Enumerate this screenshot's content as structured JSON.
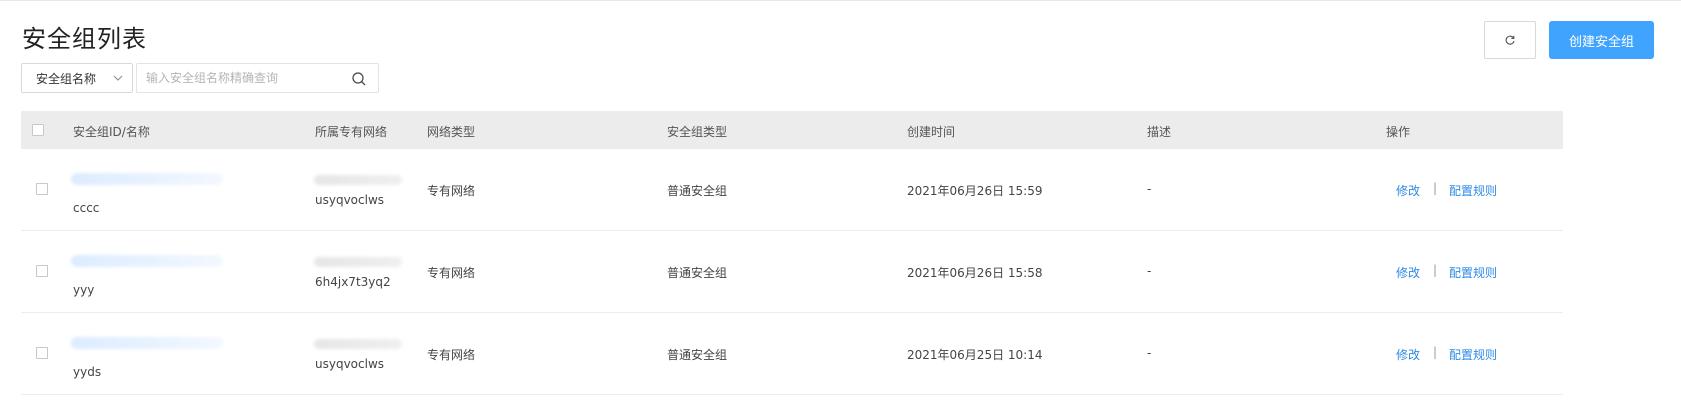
{
  "page": {
    "title": "安全组列表"
  },
  "toolbar": {
    "create_label": "创建安全组"
  },
  "filter": {
    "field_selected": "安全组名称",
    "search_placeholder": "输入安全组名称精确查询",
    "search_value": ""
  },
  "table": {
    "headers": {
      "id_name": "安全组ID/名称",
      "vpc": "所属专有网络",
      "network_type": "网络类型",
      "group_type": "安全组类型",
      "created": "创建时间",
      "desc": "描述",
      "actions": "操作"
    },
    "rows": [
      {
        "name": "cccc",
        "vpc_suffix": "usyqvoclws",
        "network_type": "专有网络",
        "group_type": "普通安全组",
        "created": "2021年06月26日 15:59",
        "desc": "-",
        "action_edit": "修改",
        "action_sep": "|",
        "action_rules": "配置规则"
      },
      {
        "name": "yyy",
        "vpc_suffix": "6h4jx7t3yq2",
        "network_type": "专有网络",
        "group_type": "普通安全组",
        "created": "2021年06月26日 15:58",
        "desc": "-",
        "action_edit": "修改",
        "action_sep": "|",
        "action_rules": "配置规则"
      },
      {
        "name": "yyds",
        "vpc_suffix": "usyqvoclws",
        "network_type": "专有网络",
        "group_type": "普通安全组",
        "created": "2021年06月25日 10:14",
        "desc": "-",
        "action_edit": "修改",
        "action_sep": "|",
        "action_rules": "配置规则"
      }
    ]
  },
  "icons": {
    "refresh": "refresh-icon",
    "chevron": "chevron-down-icon",
    "search": "search-icon"
  },
  "colors": {
    "accent": "#40a4ff",
    "link": "#2e8ae6",
    "header_bg": "#ececec"
  }
}
